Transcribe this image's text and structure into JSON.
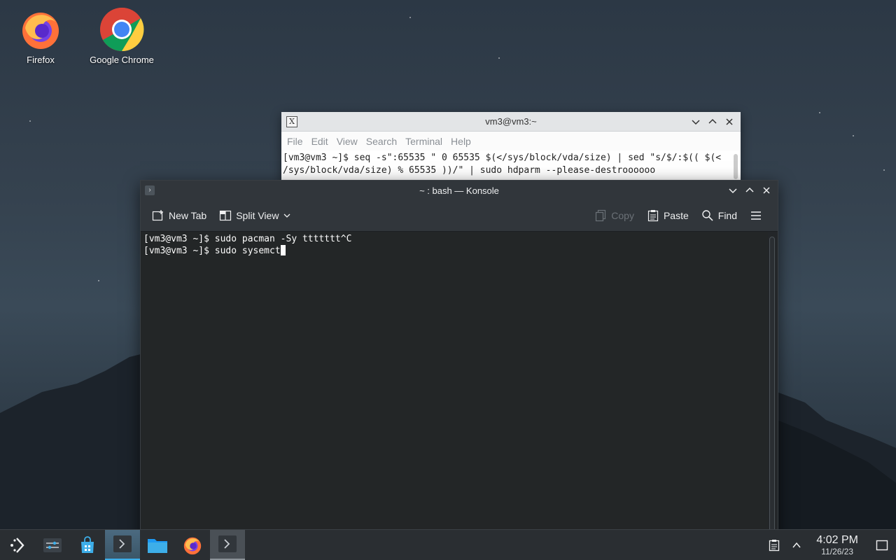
{
  "desktop": {
    "icons": [
      {
        "label": "Firefox",
        "icon": "firefox-icon"
      },
      {
        "label": "Google Chrome",
        "icon": "chrome-icon"
      }
    ]
  },
  "xterm_window": {
    "title": "vm3@vm3:~",
    "menu": [
      "File",
      "Edit",
      "View",
      "Search",
      "Terminal",
      "Help"
    ],
    "lines": [
      "[vm3@vm3 ~]$ seq -s\":65535 \" 0 65535 $(</sys/block/vda/size) | sed \"s/$/:$(( $(<",
      "/sys/block/vda/size) % 65535 ))/\" | sudo hdparm --please-destroooooo"
    ]
  },
  "konsole": {
    "title": "~ : bash — Konsole",
    "toolbar": {
      "new_tab": "New Tab",
      "split_view": "Split View",
      "copy": "Copy",
      "paste": "Paste",
      "find": "Find"
    },
    "lines": [
      "[vm3@vm3 ~]$ sudo pacman -Sy ttttttt^C",
      "[vm3@vm3 ~]$ sudo sysemct"
    ]
  },
  "taskbar": {
    "items": [
      "application-launcher-icon",
      "system-settings-icon",
      "discover-store-icon",
      "konsole-icon",
      "dolphin-files-icon",
      "firefox-icon",
      "terminal-icon"
    ],
    "clock": {
      "time": "4:02 PM",
      "date": "11/26/23"
    },
    "accent": "#3daee9"
  }
}
